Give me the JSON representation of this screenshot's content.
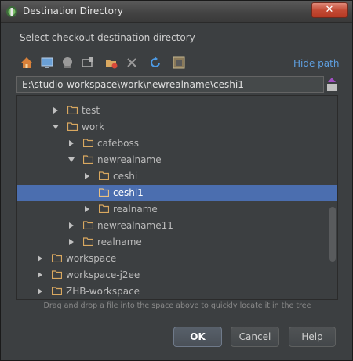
{
  "window": {
    "title": "Destination Directory",
    "close_label": "✕"
  },
  "dialog": {
    "subtitle": "Select checkout destination directory",
    "hide_path_label": "Hide path",
    "path_value": "E:\\studio-workspace\\work\\newrealname\\ceshi1",
    "hint": "Drag and drop a file into the space above to quickly locate it in the tree"
  },
  "toolbar": {
    "icons": [
      "home-icon",
      "desktop-icon",
      "project-icon",
      "module-icon",
      "new-folder-icon",
      "delete-icon",
      "refresh-icon",
      "show-hidden-icon"
    ]
  },
  "tree": {
    "rows": [
      {
        "label": "test",
        "expanded": false
      },
      {
        "label": "work",
        "expanded": true
      },
      {
        "label": "cafeboss",
        "expanded": false
      },
      {
        "label": "newrealname",
        "expanded": true
      },
      {
        "label": "ceshi",
        "expanded": false
      },
      {
        "label": "ceshi1",
        "expanded": null,
        "selected": true
      },
      {
        "label": "realname",
        "expanded": false
      },
      {
        "label": "newrealname11",
        "expanded": false
      },
      {
        "label": "realname",
        "expanded": false
      },
      {
        "label": "workspace",
        "expanded": false
      },
      {
        "label": "workspace-j2ee",
        "expanded": false
      },
      {
        "label": "ZHB-workspace",
        "expanded": false
      }
    ]
  },
  "buttons": {
    "ok": "OK",
    "cancel": "Cancel",
    "help": "Help"
  },
  "colors": {
    "background": "#3c3f41",
    "selection": "#4b6eaf",
    "link": "#5e9fe0",
    "folder": "#d9a860"
  }
}
